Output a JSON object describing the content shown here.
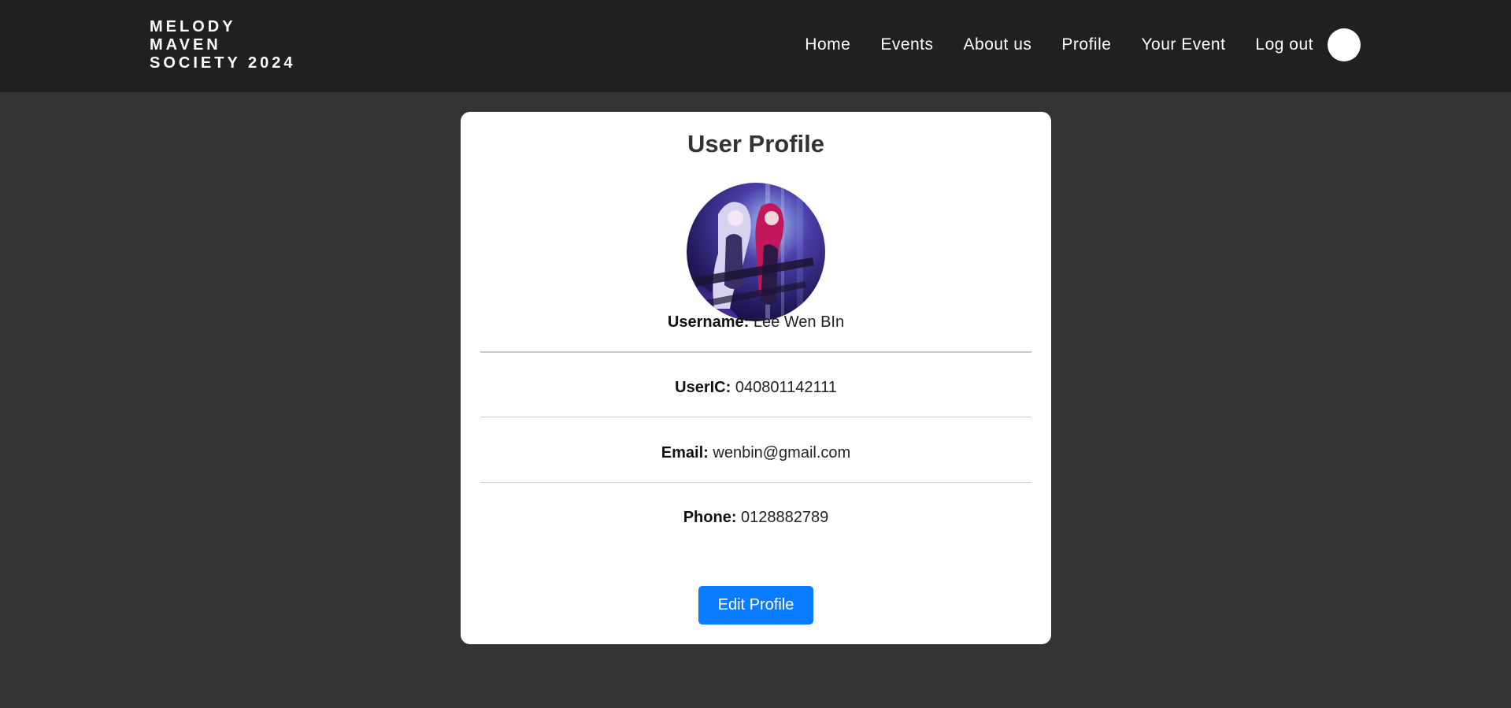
{
  "header": {
    "brand_lines": [
      "MELODY",
      "MAVEN",
      "SOCIETY 2024"
    ],
    "nav": {
      "home": "Home",
      "events": "Events",
      "about": "About us",
      "profile": "Profile",
      "your_event": "Your Event",
      "logout": "Log out"
    }
  },
  "profile": {
    "title": "User Profile",
    "avatar_icon": "user-avatar-image",
    "fields": {
      "username_label": "Username:",
      "username_value": "Lee Wen BIn",
      "useric_label": "UserIC:",
      "useric_value": "040801142111",
      "email_label": "Email:",
      "email_value": "wenbin@gmail.com",
      "phone_label": "Phone:",
      "phone_value": "0128882789"
    },
    "edit_button": "Edit Profile"
  },
  "colors": {
    "page_background": "#333333",
    "navbar_background": "#202020",
    "card_background": "#ffffff",
    "accent_button": "#0a7cff"
  }
}
